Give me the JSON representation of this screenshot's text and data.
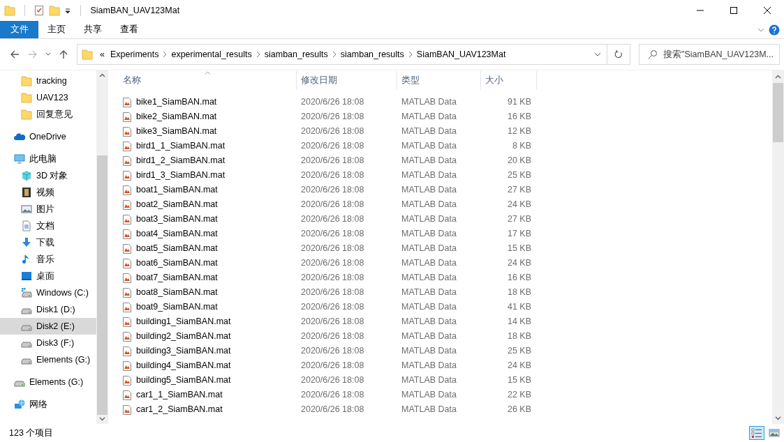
{
  "window": {
    "title": "SiamBAN_UAV123Mat"
  },
  "ribbon_tabs": [
    {
      "label": "文件",
      "kind": "file",
      "selected": false
    },
    {
      "label": "主页",
      "kind": "tab",
      "selected": false
    },
    {
      "label": "共享",
      "kind": "tab",
      "selected": false
    },
    {
      "label": "查看",
      "kind": "tab",
      "selected": false
    }
  ],
  "navigation": {
    "back_disabled": false,
    "forward_disabled": true
  },
  "address_bar": {
    "overflow": "«",
    "path": [
      "Experiments",
      "experimental_results",
      "siamban_results",
      "siamban_results",
      "SiamBAN_UAV123Mat"
    ]
  },
  "search": {
    "placeholder": "搜索\"SiamBAN_UAV123M..."
  },
  "sidebar": {
    "items": [
      {
        "children": [
          {
            "label": "tracking",
            "kind": "folder",
            "selected": false
          },
          {
            "label": "UAV123",
            "kind": "folder",
            "selected": false
          },
          {
            "label": "回复意见",
            "kind": "folder",
            "selected": false
          }
        ]
      },
      {
        "label": "OneDrive",
        "kind": "cloud",
        "selected": false
      },
      {
        "label": "此电脑",
        "kind": "pc",
        "selected": false,
        "children": [
          {
            "label": "3D 对象",
            "kind": "cube",
            "selected": false
          },
          {
            "label": "视频",
            "kind": "video",
            "selected": false
          },
          {
            "label": "图片",
            "kind": "pictures",
            "selected": false
          },
          {
            "label": "文档",
            "kind": "documents",
            "selected": false
          },
          {
            "label": "下载",
            "kind": "download",
            "selected": false
          },
          {
            "label": "音乐",
            "kind": "music",
            "selected": false
          },
          {
            "label": "桌面",
            "kind": "desktop",
            "selected": false
          },
          {
            "label": "Windows (C:)",
            "kind": "windrive",
            "selected": false
          },
          {
            "label": "Disk1 (D:)",
            "kind": "drive",
            "selected": false
          },
          {
            "label": "Disk2 (E:)",
            "kind": "drive",
            "selected": true
          },
          {
            "label": "Disk3 (F:)",
            "kind": "drive",
            "selected": false
          },
          {
            "label": "Elements (G:)",
            "kind": "drive",
            "selected": false
          }
        ]
      },
      {
        "label": "Elements (G:)",
        "kind": "drive",
        "selected": false
      },
      {
        "label": "网络",
        "kind": "network",
        "selected": false
      }
    ]
  },
  "table": {
    "columns": [
      {
        "label": "名称",
        "sorted": true
      },
      {
        "label": "修改日期",
        "sorted": false
      },
      {
        "label": "类型",
        "sorted": false
      },
      {
        "label": "大小",
        "sorted": false
      }
    ],
    "rows": [
      [
        "bike1_SiamBAN.mat",
        "2020/6/26 18:08",
        "MATLAB Data",
        "91 KB"
      ],
      [
        "bike2_SiamBAN.mat",
        "2020/6/26 18:08",
        "MATLAB Data",
        "16 KB"
      ],
      [
        "bike3_SiamBAN.mat",
        "2020/6/26 18:08",
        "MATLAB Data",
        "12 KB"
      ],
      [
        "bird1_1_SiamBAN.mat",
        "2020/6/26 18:08",
        "MATLAB Data",
        "8 KB"
      ],
      [
        "bird1_2_SiamBAN.mat",
        "2020/6/26 18:08",
        "MATLAB Data",
        "20 KB"
      ],
      [
        "bird1_3_SiamBAN.mat",
        "2020/6/26 18:08",
        "MATLAB Data",
        "25 KB"
      ],
      [
        "boat1_SiamBAN.mat",
        "2020/6/26 18:08",
        "MATLAB Data",
        "27 KB"
      ],
      [
        "boat2_SiamBAN.mat",
        "2020/6/26 18:08",
        "MATLAB Data",
        "24 KB"
      ],
      [
        "boat3_SiamBAN.mat",
        "2020/6/26 18:08",
        "MATLAB Data",
        "27 KB"
      ],
      [
        "boat4_SiamBAN.mat",
        "2020/6/26 18:08",
        "MATLAB Data",
        "17 KB"
      ],
      [
        "boat5_SiamBAN.mat",
        "2020/6/26 18:08",
        "MATLAB Data",
        "15 KB"
      ],
      [
        "boat6_SiamBAN.mat",
        "2020/6/26 18:08",
        "MATLAB Data",
        "24 KB"
      ],
      [
        "boat7_SiamBAN.mat",
        "2020/6/26 18:08",
        "MATLAB Data",
        "16 KB"
      ],
      [
        "boat8_SiamBAN.mat",
        "2020/6/26 18:08",
        "MATLAB Data",
        "18 KB"
      ],
      [
        "boat9_SiamBAN.mat",
        "2020/6/26 18:08",
        "MATLAB Data",
        "41 KB"
      ],
      [
        "building1_SiamBAN.mat",
        "2020/6/26 18:08",
        "MATLAB Data",
        "14 KB"
      ],
      [
        "building2_SiamBAN.mat",
        "2020/6/26 18:08",
        "MATLAB Data",
        "18 KB"
      ],
      [
        "building3_SiamBAN.mat",
        "2020/6/26 18:08",
        "MATLAB Data",
        "25 KB"
      ],
      [
        "building4_SiamBAN.mat",
        "2020/6/26 18:08",
        "MATLAB Data",
        "24 KB"
      ],
      [
        "building5_SiamBAN.mat",
        "2020/6/26 18:08",
        "MATLAB Data",
        "15 KB"
      ],
      [
        "car1_1_SiamBAN.mat",
        "2020/6/26 18:08",
        "MATLAB Data",
        "22 KB"
      ],
      [
        "car1_2_SiamBAN.mat",
        "2020/6/26 18:08",
        "MATLAB Data",
        "26 KB"
      ]
    ]
  },
  "status_bar": {
    "item_count": "123 个项目",
    "view": [
      {
        "kind": "details",
        "selected": true
      },
      {
        "kind": "thumbnails",
        "selected": false
      }
    ]
  }
}
